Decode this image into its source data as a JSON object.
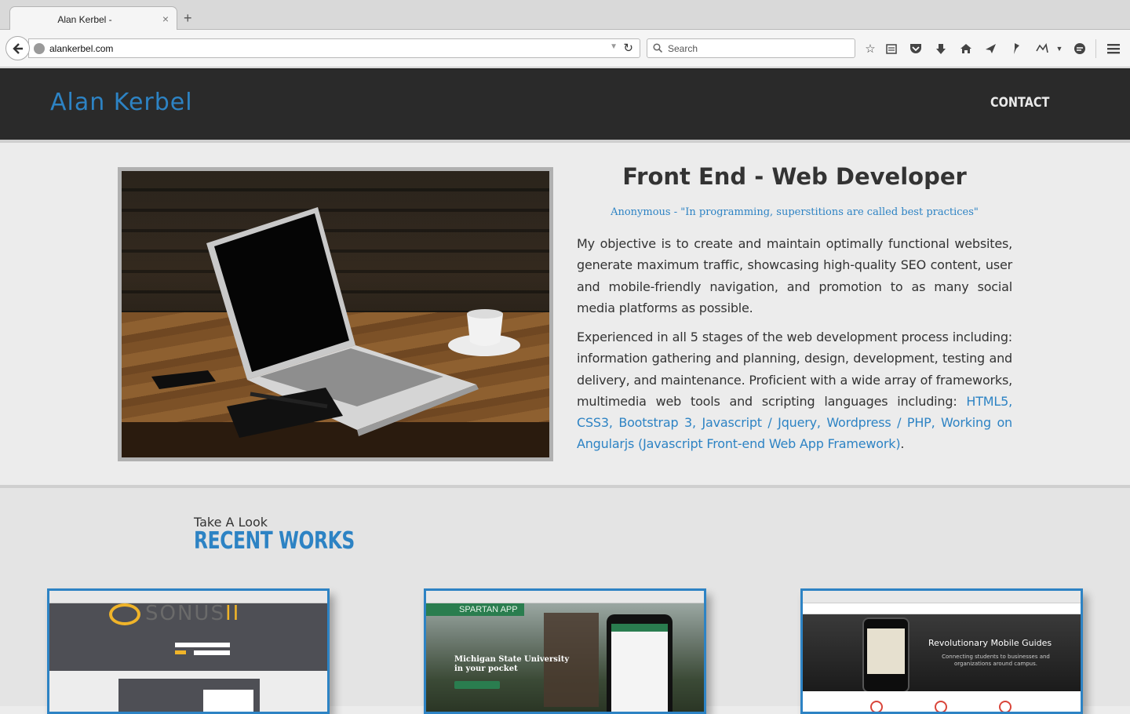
{
  "browser": {
    "tab_title": "Alan Kerbel -",
    "tab_close": "×",
    "new_tab": "+",
    "url": "alankerbel.com",
    "search_placeholder": "Search",
    "toolbar_icons": [
      "bookmark-star-icon",
      "reading-list-icon",
      "pocket-icon",
      "download-icon",
      "home-icon",
      "send-icon",
      "pin-icon",
      "extension-icon",
      "chat-icon",
      "hamburger-menu-icon"
    ]
  },
  "site": {
    "logo": "Alan Kerbel",
    "nav": {
      "contact": "CONTACT"
    },
    "colors": {
      "accent": "#2d83c4",
      "header_bg": "#2a2a2a"
    }
  },
  "about": {
    "headline": "Front End - Web Developer",
    "quote": "Anonymous - \"In programming, superstitions are called best practices\"",
    "paragraph1": "My objective is to create and maintain optimally functional websites, generate maximum traffic, showcasing high-quality SEO content, user and mobile-friendly navigation, and promotion to as many social media platforms as possible.",
    "paragraph2_text": "Experienced in all 5 stages of the web development process including: information gathering and planning, design, development, testing and delivery, and maintenance. Proficient with a wide array of frameworks, multimedia web tools and scripting languages including:",
    "paragraph2_skills": "HTML5, CSS3, Bootstrap 3, Javascript / Jquery, Wordpress / PHP, Working on Angularjs (Javascript Front-end Web App Framework)",
    "paragraph2_end": "."
  },
  "works": {
    "kicker": "Take A Look",
    "title": "RECENT WORKS",
    "items": [
      {
        "logo_main": "SONUS",
        "logo_suffix": "II"
      },
      {
        "badge": "SPARTAN APP",
        "caption": "Michigan State University in your pocket"
      },
      {
        "title": "Revolutionary Mobile Guides",
        "subtitle": "Connecting students to businesses and organizations around campus."
      }
    ]
  }
}
